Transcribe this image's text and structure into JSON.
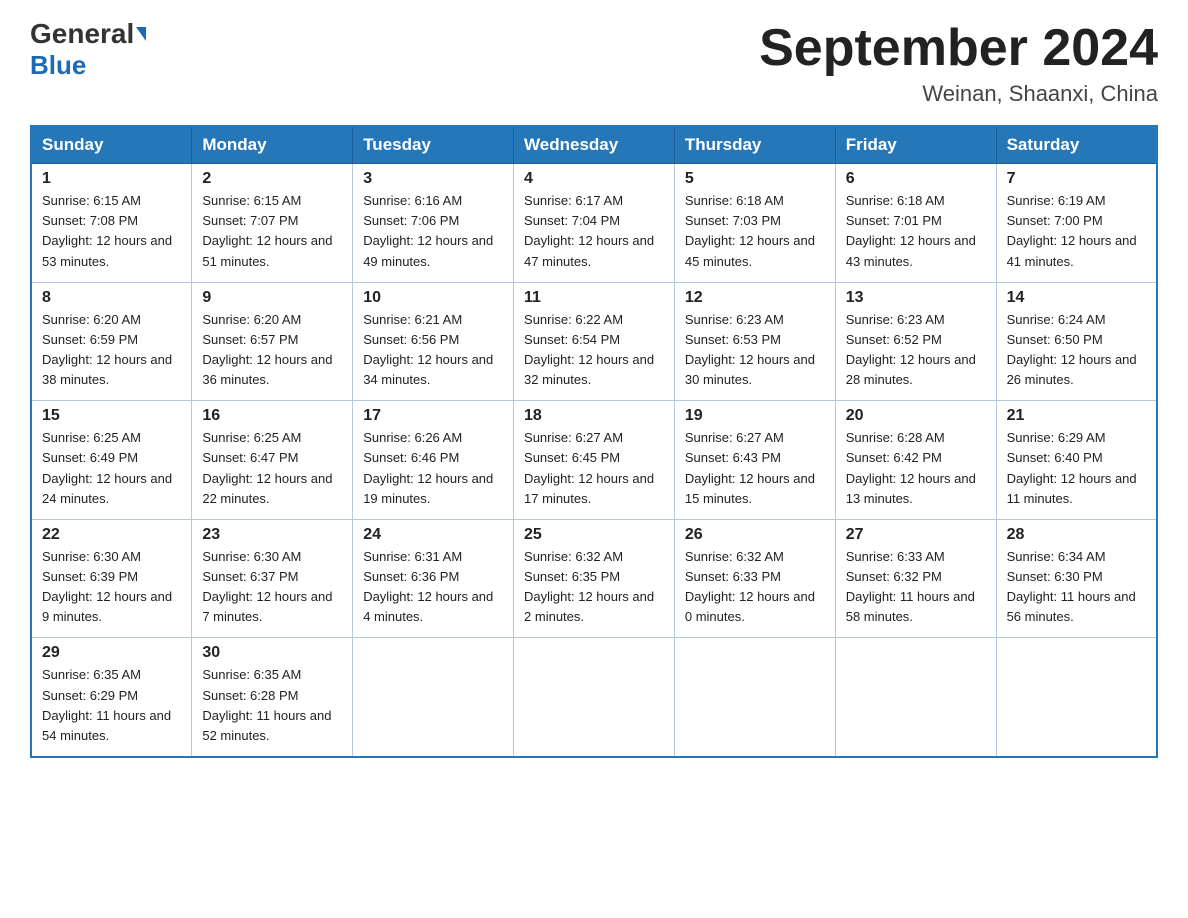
{
  "header": {
    "logo_general": "General",
    "logo_blue": "Blue",
    "month_title": "September 2024",
    "location": "Weinan, Shaanxi, China"
  },
  "weekdays": [
    "Sunday",
    "Monday",
    "Tuesday",
    "Wednesday",
    "Thursday",
    "Friday",
    "Saturday"
  ],
  "weeks": [
    [
      {
        "day": "1",
        "sunrise": "6:15 AM",
        "sunset": "7:08 PM",
        "daylight": "12 hours and 53 minutes."
      },
      {
        "day": "2",
        "sunrise": "6:15 AM",
        "sunset": "7:07 PM",
        "daylight": "12 hours and 51 minutes."
      },
      {
        "day": "3",
        "sunrise": "6:16 AM",
        "sunset": "7:06 PM",
        "daylight": "12 hours and 49 minutes."
      },
      {
        "day": "4",
        "sunrise": "6:17 AM",
        "sunset": "7:04 PM",
        "daylight": "12 hours and 47 minutes."
      },
      {
        "day": "5",
        "sunrise": "6:18 AM",
        "sunset": "7:03 PM",
        "daylight": "12 hours and 45 minutes."
      },
      {
        "day": "6",
        "sunrise": "6:18 AM",
        "sunset": "7:01 PM",
        "daylight": "12 hours and 43 minutes."
      },
      {
        "day": "7",
        "sunrise": "6:19 AM",
        "sunset": "7:00 PM",
        "daylight": "12 hours and 41 minutes."
      }
    ],
    [
      {
        "day": "8",
        "sunrise": "6:20 AM",
        "sunset": "6:59 PM",
        "daylight": "12 hours and 38 minutes."
      },
      {
        "day": "9",
        "sunrise": "6:20 AM",
        "sunset": "6:57 PM",
        "daylight": "12 hours and 36 minutes."
      },
      {
        "day": "10",
        "sunrise": "6:21 AM",
        "sunset": "6:56 PM",
        "daylight": "12 hours and 34 minutes."
      },
      {
        "day": "11",
        "sunrise": "6:22 AM",
        "sunset": "6:54 PM",
        "daylight": "12 hours and 32 minutes."
      },
      {
        "day": "12",
        "sunrise": "6:23 AM",
        "sunset": "6:53 PM",
        "daylight": "12 hours and 30 minutes."
      },
      {
        "day": "13",
        "sunrise": "6:23 AM",
        "sunset": "6:52 PM",
        "daylight": "12 hours and 28 minutes."
      },
      {
        "day": "14",
        "sunrise": "6:24 AM",
        "sunset": "6:50 PM",
        "daylight": "12 hours and 26 minutes."
      }
    ],
    [
      {
        "day": "15",
        "sunrise": "6:25 AM",
        "sunset": "6:49 PM",
        "daylight": "12 hours and 24 minutes."
      },
      {
        "day": "16",
        "sunrise": "6:25 AM",
        "sunset": "6:47 PM",
        "daylight": "12 hours and 22 minutes."
      },
      {
        "day": "17",
        "sunrise": "6:26 AM",
        "sunset": "6:46 PM",
        "daylight": "12 hours and 19 minutes."
      },
      {
        "day": "18",
        "sunrise": "6:27 AM",
        "sunset": "6:45 PM",
        "daylight": "12 hours and 17 minutes."
      },
      {
        "day": "19",
        "sunrise": "6:27 AM",
        "sunset": "6:43 PM",
        "daylight": "12 hours and 15 minutes."
      },
      {
        "day": "20",
        "sunrise": "6:28 AM",
        "sunset": "6:42 PM",
        "daylight": "12 hours and 13 minutes."
      },
      {
        "day": "21",
        "sunrise": "6:29 AM",
        "sunset": "6:40 PM",
        "daylight": "12 hours and 11 minutes."
      }
    ],
    [
      {
        "day": "22",
        "sunrise": "6:30 AM",
        "sunset": "6:39 PM",
        "daylight": "12 hours and 9 minutes."
      },
      {
        "day": "23",
        "sunrise": "6:30 AM",
        "sunset": "6:37 PM",
        "daylight": "12 hours and 7 minutes."
      },
      {
        "day": "24",
        "sunrise": "6:31 AM",
        "sunset": "6:36 PM",
        "daylight": "12 hours and 4 minutes."
      },
      {
        "day": "25",
        "sunrise": "6:32 AM",
        "sunset": "6:35 PM",
        "daylight": "12 hours and 2 minutes."
      },
      {
        "day": "26",
        "sunrise": "6:32 AM",
        "sunset": "6:33 PM",
        "daylight": "12 hours and 0 minutes."
      },
      {
        "day": "27",
        "sunrise": "6:33 AM",
        "sunset": "6:32 PM",
        "daylight": "11 hours and 58 minutes."
      },
      {
        "day": "28",
        "sunrise": "6:34 AM",
        "sunset": "6:30 PM",
        "daylight": "11 hours and 56 minutes."
      }
    ],
    [
      {
        "day": "29",
        "sunrise": "6:35 AM",
        "sunset": "6:29 PM",
        "daylight": "11 hours and 54 minutes."
      },
      {
        "day": "30",
        "sunrise": "6:35 AM",
        "sunset": "6:28 PM",
        "daylight": "11 hours and 52 minutes."
      },
      null,
      null,
      null,
      null,
      null
    ]
  ]
}
